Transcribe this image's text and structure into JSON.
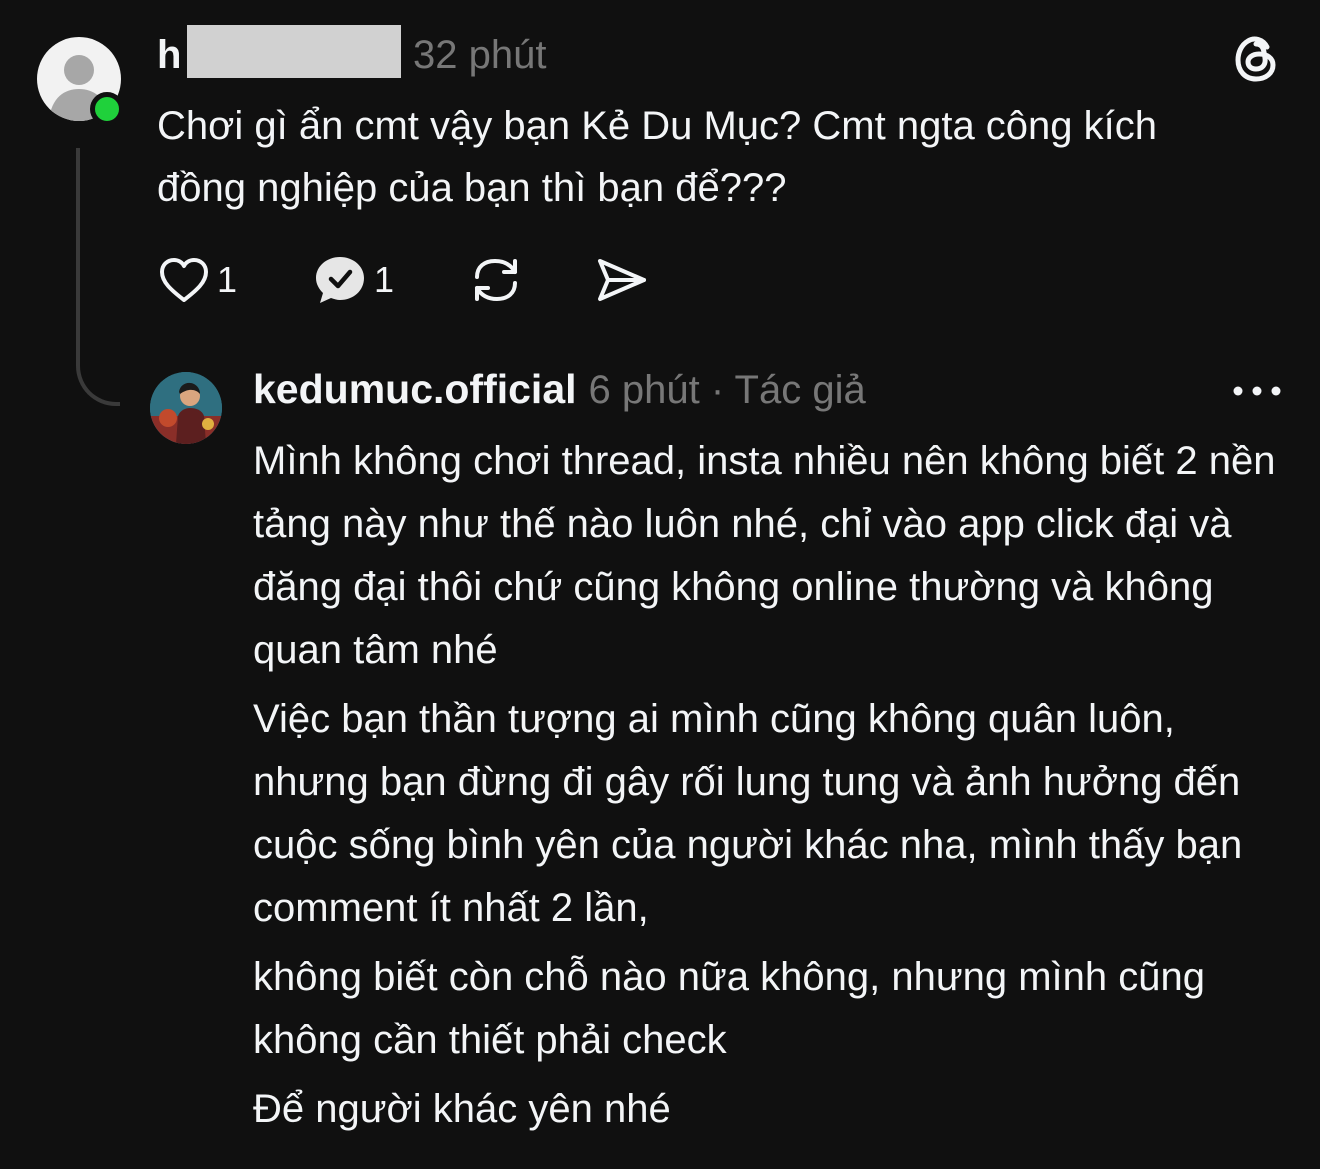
{
  "post": {
    "username_visible": "h",
    "time": "32 phút",
    "text": "Chơi gì ẩn cmt vậy bạn Kẻ Du Mục? Cmt ngta công kích đồng nghiệp của bạn thì bạn để???",
    "likes": "1",
    "replies": "1"
  },
  "reply": {
    "username": "kedumuc.official",
    "meta": "6 phút · Tác giả",
    "paragraphs": [
      "Mình không chơi thread, insta nhiều nên không biết 2 nền tảng này như thế nào luôn nhé, chỉ vào app click đại và đăng đại thôi chứ cũng không online thường và không quan tâm nhé",
      "Việc bạn thần tượng ai mình cũng không quân luôn, nhưng bạn đừng đi gây rối lung tung và ảnh hưởng đến cuộc sống bình yên của người khác nha, mình thấy bạn comment ít nhất 2 lần,",
      "không biết còn chỗ nào nữa không, nhưng mình cũng không cần thiết phải check",
      "Để người khác yên nhé"
    ]
  },
  "colors": {
    "background": "#101010",
    "text_primary": "#f3f5f7",
    "text_secondary": "#777777",
    "online": "#1fd13b"
  },
  "icons": {
    "like": "heart-icon",
    "reply": "reply-bubble-icon",
    "repost": "repost-icon",
    "share": "share-icon",
    "brand": "threads-logo-icon",
    "more": "more-dots-icon"
  }
}
